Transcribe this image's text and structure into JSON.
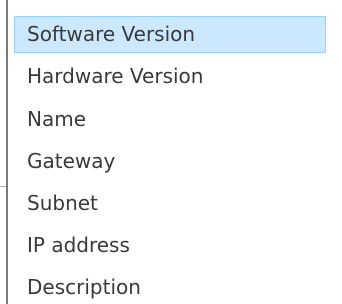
{
  "list": {
    "items": [
      {
        "label": "Software Version",
        "selected": true
      },
      {
        "label": "Hardware Version",
        "selected": false
      },
      {
        "label": "Name",
        "selected": false
      },
      {
        "label": "Gateway",
        "selected": false
      },
      {
        "label": "Subnet",
        "selected": false
      },
      {
        "label": "IP address",
        "selected": false
      },
      {
        "label": "Description",
        "selected": false
      }
    ]
  },
  "colors": {
    "selection_background": "#cce8ff",
    "selection_border": "#99d1ff",
    "text": "#3a3a3a"
  }
}
